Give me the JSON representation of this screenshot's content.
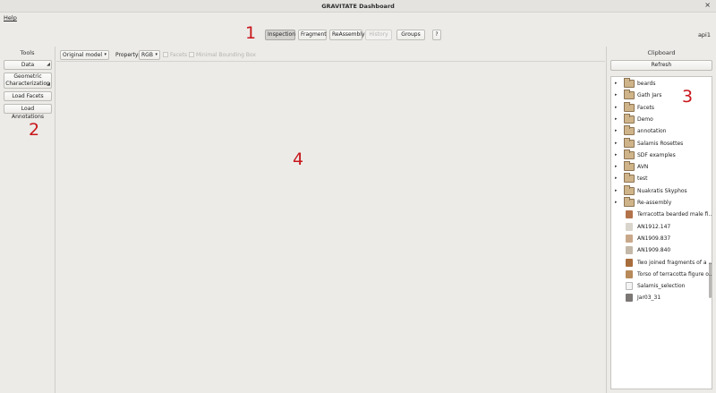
{
  "window": {
    "title": "GRAVITATE Dashboard",
    "close_glyph": "×"
  },
  "menu": {
    "help": "Help"
  },
  "callouts": {
    "top": "1",
    "left": "2",
    "right": "3",
    "center": "4"
  },
  "toolbar": {
    "inspection": "Inspection",
    "fragment": "Fragment",
    "reassembly": "ReAssembly",
    "history": "History",
    "groups": "Groups",
    "help": "?"
  },
  "user": "api1",
  "tools": {
    "title": "Tools",
    "data": "Data",
    "geometric_line1": "Geometric",
    "geometric_line2": "Characterization",
    "load_facets": "Load Facets",
    "load_annotations": "Load Annotations"
  },
  "viewer": {
    "model_select": "Original model",
    "property_label": "Property:",
    "property_select": "RGB",
    "facets": "Facets",
    "minimal_bounding_box": "Minimal Bounding Box"
  },
  "clipboard": {
    "title": "Clipboard",
    "refresh": "Refresh",
    "folders": [
      "beards",
      "Gath Jars",
      "Facets",
      "Demo",
      "annotation",
      "Salamis Rosettes",
      "SDF examples",
      "AVN",
      "test",
      "Nuakratis Skyphos",
      "Re-assembly"
    ],
    "items": [
      {
        "label": "Terracotta bearded male fi...",
        "icon": "statue-thumbnail",
        "color": "#b2734a"
      },
      {
        "label": "AN1912.147",
        "icon": "fragment-thumbnail",
        "color": "#d9d4cc"
      },
      {
        "label": "AN1909.837",
        "icon": "fragment-thumbnail",
        "color": "#c9a88a"
      },
      {
        "label": "AN1909.840",
        "icon": "fragment-thumbnail",
        "color": "#c4b8a8"
      },
      {
        "label": "Two joined fragments of a ...",
        "icon": "fragment-thumbnail",
        "color": "#a86d3d"
      },
      {
        "label": "Torso of terracotta figure o...",
        "icon": "statue-thumbnail",
        "color": "#b88a5a"
      },
      {
        "label": "Salamis_selection",
        "icon": "document-icon",
        "color": "#f4f4f4"
      },
      {
        "label": "Jar03_31",
        "icon": "jar-thumbnail",
        "color": "#7a7775"
      }
    ]
  }
}
